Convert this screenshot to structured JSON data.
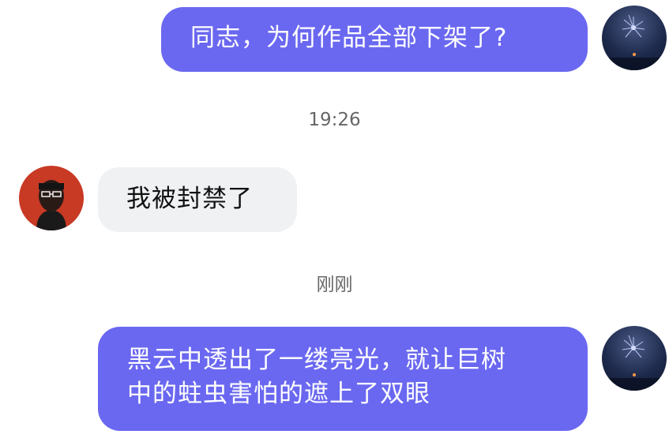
{
  "messages": [
    {
      "side": "right",
      "text": "同志，为何作品全部下架了?"
    },
    {
      "type": "timestamp",
      "text": "19:26"
    },
    {
      "side": "left",
      "text": "我被封禁了"
    },
    {
      "type": "timestamp",
      "text": "刚刚"
    },
    {
      "side": "right",
      "lines": [
        "黑云中透出了一缕亮光，就让巨树",
        "中的蛀虫害怕的遮上了双眼"
      ]
    }
  ],
  "colors": {
    "outgoing_bubble": "#6a68f0",
    "incoming_bubble": "#f0f1f3",
    "timestamp_text": "#666666"
  },
  "avatars": {
    "self": "night-sky-fireworks-avatar",
    "other": "red-portrait-avatar"
  }
}
